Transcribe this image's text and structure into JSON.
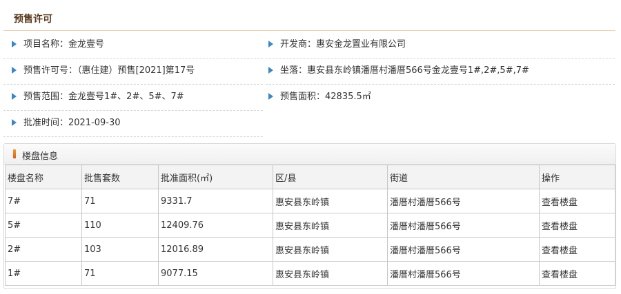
{
  "title": "预售许可",
  "info": {
    "project_name": {
      "label": "项目名称：",
      "value": "金龙壹号"
    },
    "developer": {
      "label": "开发商：",
      "value": "惠安金龙置业有限公司"
    },
    "permit_no": {
      "label": "预售许可号：",
      "value": "（惠住建）预售[2021]第17号"
    },
    "location": {
      "label": "坐落：",
      "value": "惠安县东岭镇潘厝村潘厝566号金龙壹号1#,2#,5#,7#"
    },
    "scope": {
      "label": "预售范围：",
      "value": "金龙壹号1#、2#、5#、7#"
    },
    "area": {
      "label": "预售面积：",
      "value": "42835.5㎡"
    },
    "approval_time": {
      "label": "批准时间：",
      "value": "2021-09-30"
    }
  },
  "buildings": {
    "title": "楼盘信息",
    "columns": [
      "楼盘名称",
      "批售套数",
      "批准面积(㎡)",
      "区/县",
      "街道",
      "操作"
    ],
    "rows": [
      {
        "name": "7#",
        "units": "71",
        "area": "9331.7",
        "district": "惠安县东岭镇",
        "street": "潘厝村潘厝566号",
        "action": "查看楼盘"
      },
      {
        "name": "5#",
        "units": "110",
        "area": "12409.76",
        "district": "惠安县东岭镇",
        "street": "潘厝村潘厝566号",
        "action": "查看楼盘"
      },
      {
        "name": "2#",
        "units": "103",
        "area": "12016.89",
        "district": "惠安县东岭镇",
        "street": "潘厝村潘厝566号",
        "action": "查看楼盘"
      },
      {
        "name": "1#",
        "units": "71",
        "area": "9077.15",
        "district": "惠安县东岭镇",
        "street": "潘厝村潘厝566号",
        "action": "查看楼盘"
      }
    ]
  }
}
